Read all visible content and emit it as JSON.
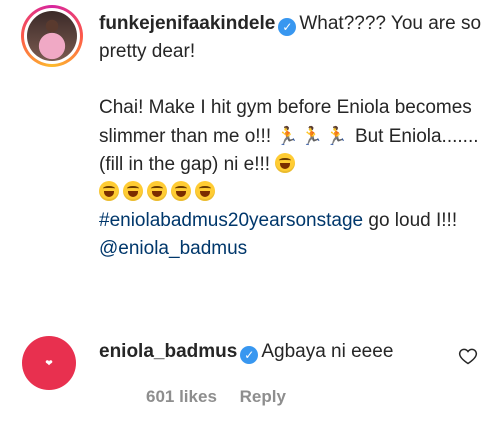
{
  "comment1": {
    "username": "funkejenifaakindele",
    "line1": "What???? You are so pretty dear!",
    "line2": "Chai! Make I hit gym before Eniola becomes slimmer than me o!!!",
    "line3": "But Eniola.......(fill in the gap) ni e!!!",
    "hashtag": "#eniolabadmus20yearsonstage",
    "after_hashtag": "go loud I!!!",
    "mention": "@eniola_badmus"
  },
  "comment2": {
    "username": "eniola_badmus",
    "text": "Agbaya ni eeee",
    "likes": "601 likes",
    "reply_label": "Reply"
  },
  "icons": [
    "verified-badge",
    "runner-emoji",
    "laughing-emoji",
    "heart-icon"
  ]
}
